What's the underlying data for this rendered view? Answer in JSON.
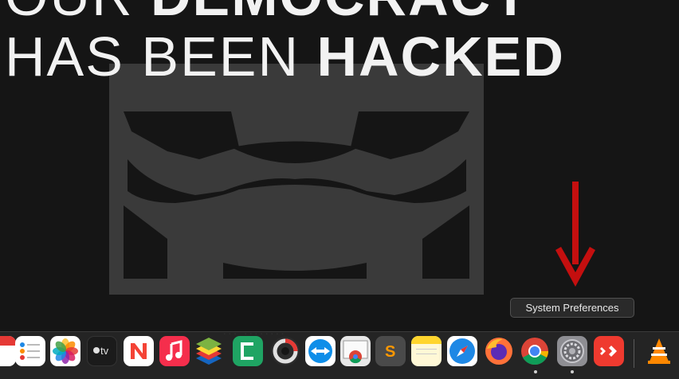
{
  "wallpaper": {
    "headline_line1_thin": "OUR ",
    "headline_line1_bold": "DEMOCRACY",
    "headline_line2_thin": "HAS BEEN ",
    "headline_line2_bold": "HACKED",
    "faint_text": "... ........",
    "colors": {
      "background": "#151515",
      "mask": "#3a3a3a",
      "text": "#f2f2f2",
      "arrow": "#c40f0f"
    }
  },
  "tooltip": {
    "label": "System Preferences"
  },
  "dock": {
    "items": [
      {
        "name": "Calendar",
        "icon": "calendar-icon"
      },
      {
        "name": "Reminders",
        "icon": "reminders-icon"
      },
      {
        "name": "Photos",
        "icon": "photos-icon"
      },
      {
        "name": "Apple TV",
        "icon": "apple-tv-icon",
        "label": "tv"
      },
      {
        "name": "News",
        "icon": "news-icon"
      },
      {
        "name": "Music",
        "icon": "music-icon"
      },
      {
        "name": "BlueStacks",
        "icon": "bluestacks-icon"
      },
      {
        "name": "Camtasia",
        "icon": "camtasia-icon"
      },
      {
        "name": "Recorder",
        "icon": "recorder-icon"
      },
      {
        "name": "TeamViewer",
        "icon": "teamviewer-icon"
      },
      {
        "name": "Chrome Apps",
        "icon": "chrome-apps-icon"
      },
      {
        "name": "Sublime Text",
        "icon": "sublime-text-icon",
        "label": "S"
      },
      {
        "name": "Notes",
        "icon": "notes-icon"
      },
      {
        "name": "Safari",
        "icon": "safari-icon"
      },
      {
        "name": "Firefox",
        "icon": "firefox-icon"
      },
      {
        "name": "Google Chrome",
        "icon": "chrome-icon",
        "running": true
      },
      {
        "name": "System Preferences",
        "icon": "system-preferences-icon",
        "running": true,
        "hovered": true
      },
      {
        "name": "AnyDesk",
        "icon": "anydesk-icon"
      },
      {
        "name": "VLC",
        "icon": "vlc-icon"
      }
    ]
  }
}
